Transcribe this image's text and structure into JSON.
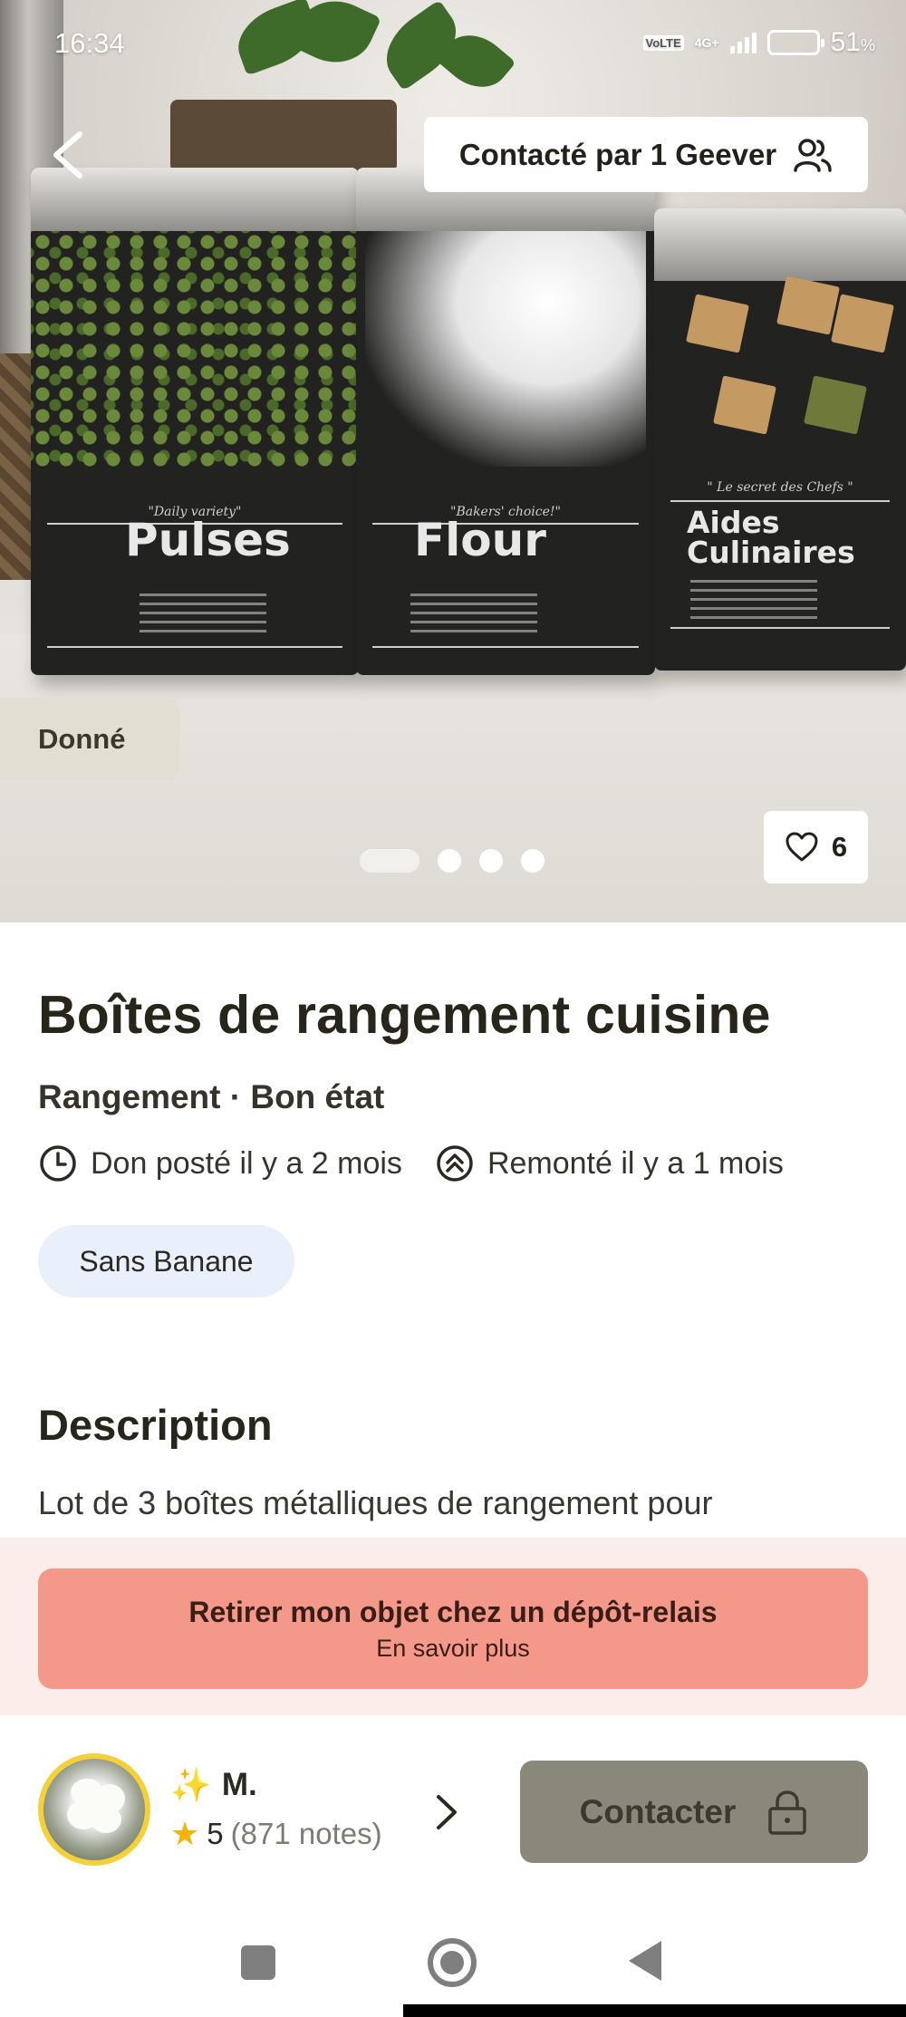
{
  "status_bar": {
    "time": "16:34",
    "volte": "VoLTE",
    "network": "4G+",
    "battery_percent": "51",
    "battery_unit": "%",
    "battery_level": 0.51
  },
  "hero": {
    "contacted_label": "Contacté par 1 Geever",
    "status_badge": "Donné",
    "likes_count": "6",
    "photo_count": 4,
    "active_photo": 1,
    "tins": [
      {
        "tagline": "\"Daily variety\"",
        "name": "Pulses"
      },
      {
        "tagline": "\"Bakers' choice!\"",
        "name": "Flour"
      },
      {
        "tagline": "\" Le secret des Chefs \"",
        "name": "Aides Culinaires"
      }
    ]
  },
  "listing": {
    "title": "Boîtes de rangement cuisine",
    "category_condition": "Rangement · Bon état",
    "posted": "Don posté il y a 2 mois",
    "bumped": "Remonté il y a 1 mois",
    "tag": "Sans Banane",
    "description_heading": "Description",
    "description": "Lot de 3 boîtes métalliques de rangement pour"
  },
  "relay": {
    "title": "Retirer mon objet chez un dépôt-relais",
    "subtitle": "En savoir plus"
  },
  "owner": {
    "sparkle": "✨",
    "name": "M.",
    "rating": "5",
    "ratings_count": "(871 notes)"
  },
  "actions": {
    "contact_label": "Contacter"
  },
  "colors": {
    "relay_button": "#f4988a",
    "relay_band": "#fbeeea",
    "contact_button": "#8a877b",
    "tag_chip": "#eaf0fb",
    "avatar_ring": "#f4d13a",
    "star": "#f4b300"
  }
}
